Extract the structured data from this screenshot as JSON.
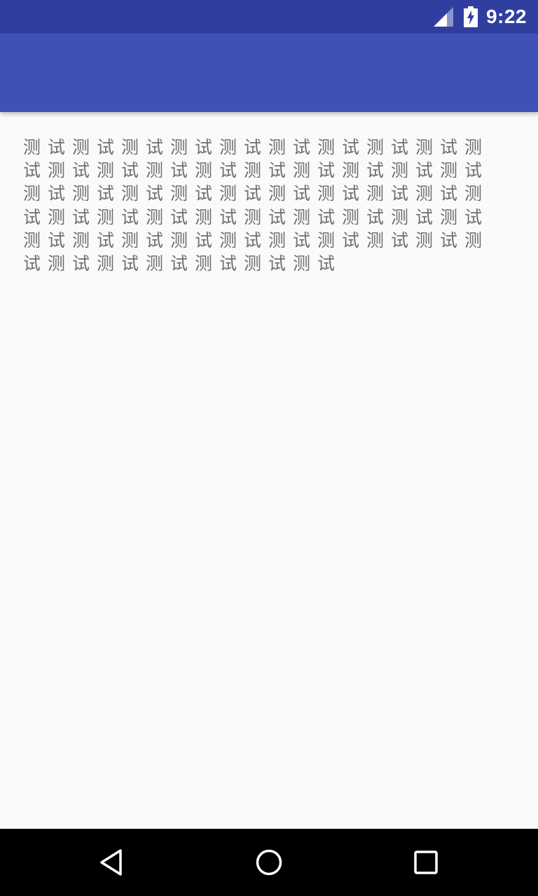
{
  "status_bar": {
    "time": "9:22",
    "icons": [
      "signal-icon",
      "battery-charging-icon"
    ],
    "color": "#303f9f"
  },
  "app_bar": {
    "color": "#3f51b5"
  },
  "content": {
    "text": "测试测试测试测试测试测试测试测试测试测试测试测试测试测试测试测试测试测试测试测试测试测试测试测试测试测试测试测试测试测试测试测试测试测试测试测试测试测试测试测试测试测试测试测试测试测试测试测试测试测试测试测试测试测试",
    "text_color": "#6f6f6f"
  },
  "nav_bar": {
    "buttons": [
      "back-icon",
      "home-icon",
      "recents-icon"
    ]
  }
}
